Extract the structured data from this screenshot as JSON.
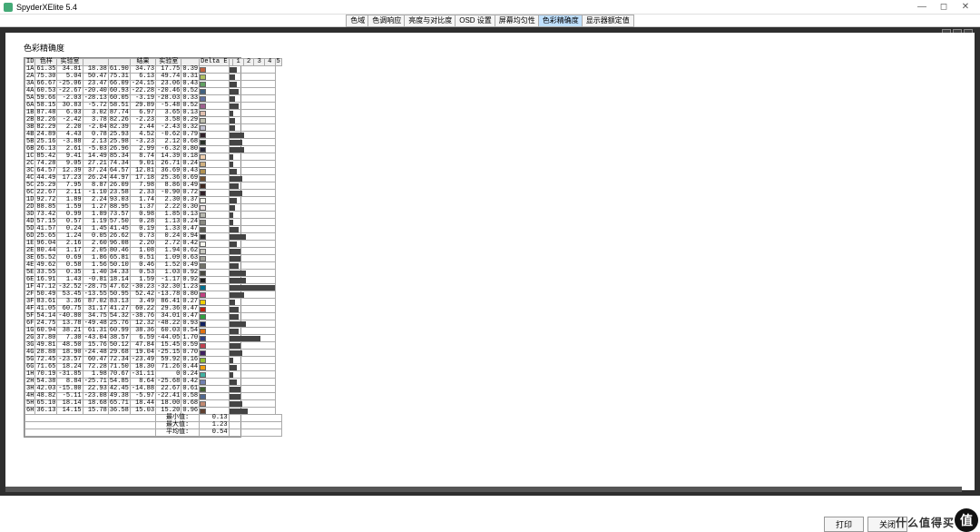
{
  "app": {
    "title": "SpyderXElite 5.4"
  },
  "winbtns": {
    "min": "—",
    "max": "◻",
    "close": "✕"
  },
  "tabs": [
    {
      "label": "色域"
    },
    {
      "label": "色调响应"
    },
    {
      "label": "亮度与对比度"
    },
    {
      "label": "OSD 设置"
    },
    {
      "label": "屏幕均匀性"
    },
    {
      "label": "色彩精确度",
      "active": true
    },
    {
      "label": "显示器额定值"
    }
  ],
  "page": {
    "title": "色彩精确度"
  },
  "columns": [
    "ID",
    "色样",
    "实验室",
    "",
    "",
    "结果",
    "实验室",
    "",
    "Delta E",
    "1",
    "2",
    "3",
    "4",
    "5"
  ],
  "rows": [
    {
      "id": "1A",
      "v": [
        "61.35",
        "34.81",
        "18.38",
        "61.90",
        "34.73",
        "17.75"
      ],
      "de": "0.39",
      "c": "#c06040",
      "b": 4
    },
    {
      "id": "2A",
      "v": [
        "75.30",
        "5.04",
        "50.47",
        "75.31",
        "6.13",
        "49.74"
      ],
      "de": "0.31",
      "c": "#b0c060",
      "b": 3
    },
    {
      "id": "3A",
      "v": [
        "66.67",
        "-25.06",
        "23.47",
        "66.09",
        "-24.15",
        "23.06"
      ],
      "de": "0.43",
      "c": "#60a060",
      "b": 4
    },
    {
      "id": "4A",
      "v": [
        "60.53",
        "-22.67",
        "-20.40",
        "60.93",
        "-22.28",
        "-20.46"
      ],
      "de": "0.52",
      "c": "#406080",
      "b": 5
    },
    {
      "id": "5A",
      "v": [
        "59.66",
        "-2.03",
        "-28.13",
        "60.05",
        "-3.19",
        "-28.03"
      ],
      "de": "0.33",
      "c": "#6070a0",
      "b": 3
    },
    {
      "id": "6A",
      "v": [
        "58.15",
        "30.83",
        "-5.72",
        "58.51",
        "29.89",
        "-5.48"
      ],
      "de": "0.52",
      "c": "#a06090",
      "b": 5
    },
    {
      "id": "1B",
      "v": [
        "87.48",
        "6.03",
        "3.02",
        "87.74",
        "6.97",
        "3.65"
      ],
      "de": "0.13",
      "c": "#e0c0b0",
      "b": 2
    },
    {
      "id": "2B",
      "v": [
        "82.26",
        "-2.42",
        "3.78",
        "82.26",
        "-2.23",
        "3.58"
      ],
      "de": "0.29",
      "c": "#c0c0b0",
      "b": 3
    },
    {
      "id": "3B",
      "v": [
        "82.29",
        "2.20",
        "-2.04",
        "82.39",
        "2.44",
        "-2.43"
      ],
      "de": "0.32",
      "c": "#c0c0d0",
      "b": 3
    },
    {
      "id": "4B",
      "v": [
        "24.89",
        "4.43",
        "0.78",
        "25.93",
        "4.52",
        "-0.62"
      ],
      "de": "0.79",
      "c": "#302028",
      "b": 8
    },
    {
      "id": "5B",
      "v": [
        "25.16",
        "-3.88",
        "2.13",
        "25.98",
        "-3.23",
        "2.12"
      ],
      "de": "0.68",
      "c": "#283028",
      "b": 7
    },
    {
      "id": "6B",
      "v": [
        "26.13",
        "2.61",
        "-5.03",
        "26.96",
        "2.99",
        "-6.32"
      ],
      "de": "0.80",
      "c": "#282838",
      "b": 8
    },
    {
      "id": "1C",
      "v": [
        "85.42",
        "9.41",
        "14.49",
        "85.34",
        "8.74",
        "14.39"
      ],
      "de": "0.18",
      "c": "#f0d0b0",
      "b": 2
    },
    {
      "id": "2C",
      "v": [
        "74.28",
        "9.05",
        "27.21",
        "74.34",
        "9.01",
        "26.71"
      ],
      "de": "0.24",
      "c": "#d0b080",
      "b": 2
    },
    {
      "id": "3C",
      "v": [
        "64.57",
        "12.39",
        "37.24",
        "64.57",
        "12.81",
        "36.69"
      ],
      "de": "0.43",
      "c": "#b09050",
      "b": 4
    },
    {
      "id": "4C",
      "v": [
        "44.49",
        "17.23",
        "26.24",
        "44.97",
        "17.18",
        "25.36"
      ],
      "de": "0.69",
      "c": "#705030",
      "b": 7
    },
    {
      "id": "5C",
      "v": [
        "25.29",
        "7.95",
        "8.87",
        "26.09",
        "7.98",
        "8.86"
      ],
      "de": "0.49",
      "c": "#402820",
      "b": 5
    },
    {
      "id": "6C",
      "v": [
        "22.67",
        "2.11",
        "-1.10",
        "23.58",
        "2.33",
        "-0.90"
      ],
      "de": "0.72",
      "c": "#302028",
      "b": 7
    },
    {
      "id": "1D",
      "v": [
        "92.72",
        "1.89",
        "2.24",
        "93.03",
        "1.74",
        "2.30"
      ],
      "de": "0.37",
      "c": "#f0f0e8",
      "b": 4
    },
    {
      "id": "2D",
      "v": [
        "88.85",
        "1.59",
        "1.27",
        "88.95",
        "1.37",
        "2.22"
      ],
      "de": "0.30",
      "c": "#e8e0e0",
      "b": 3
    },
    {
      "id": "3D",
      "v": [
        "73.42",
        "0.99",
        "1.89",
        "73.57",
        "0.98",
        "1.85"
      ],
      "de": "0.13",
      "c": "#b8b8b0",
      "b": 2
    },
    {
      "id": "4D",
      "v": [
        "57.15",
        "0.57",
        "1.19",
        "57.50",
        "0.28",
        "1.13"
      ],
      "de": "0.24",
      "c": "#888880",
      "b": 2
    },
    {
      "id": "5D",
      "v": [
        "41.57",
        "0.24",
        "1.45",
        "41.45",
        "0.19",
        "1.33"
      ],
      "de": "0.47",
      "c": "#585850",
      "b": 5
    },
    {
      "id": "6D",
      "v": [
        "25.65",
        "1.24",
        "0.05",
        "26.62",
        "0.73",
        "0.24"
      ],
      "de": "0.94",
      "c": "#303030",
      "b": 9
    },
    {
      "id": "1E",
      "v": [
        "96.04",
        "2.16",
        "2.60",
        "96.08",
        "2.20",
        "2.72"
      ],
      "de": "0.42",
      "c": "#f8f8f0",
      "b": 4
    },
    {
      "id": "2E",
      "v": [
        "80.44",
        "1.17",
        "2.05",
        "80.46",
        "1.08",
        "1.94"
      ],
      "de": "0.62",
      "c": "#c8c8c0",
      "b": 6
    },
    {
      "id": "3E",
      "v": [
        "65.52",
        "0.69",
        "1.86",
        "65.81",
        "0.51",
        "1.09"
      ],
      "de": "0.63",
      "c": "#a0a098",
      "b": 6
    },
    {
      "id": "4E",
      "v": [
        "49.62",
        "0.58",
        "1.56",
        "50.10",
        "0.46",
        "1.52"
      ],
      "de": "0.49",
      "c": "#707068",
      "b": 5
    },
    {
      "id": "5E",
      "v": [
        "33.55",
        "0.35",
        "1.40",
        "34.33",
        "0.53",
        "1.03"
      ],
      "de": "0.92",
      "c": "#484840",
      "b": 9
    },
    {
      "id": "6E",
      "v": [
        "16.91",
        "1.43",
        "-0.81",
        "18.14",
        "1.59",
        "-1.17"
      ],
      "de": "0.92",
      "c": "#202020",
      "b": 9
    },
    {
      "id": "1F",
      "v": [
        "47.12",
        "-32.52",
        "-28.75",
        "47.62",
        "-30.23",
        "-32.30"
      ],
      "de": "1.23",
      "c": "#007090",
      "b": 25
    },
    {
      "id": "2F",
      "v": [
        "50.49",
        "53.45",
        "-13.55",
        "50.95",
        "52.42",
        "-13.78"
      ],
      "de": "0.80",
      "c": "#c04080",
      "b": 8
    },
    {
      "id": "3F",
      "v": [
        "83.61",
        "3.36",
        "87.02",
        "83.13",
        "3.49",
        "86.41"
      ],
      "de": "0.27",
      "c": "#f0d000",
      "b": 3
    },
    {
      "id": "4F",
      "v": [
        "41.05",
        "60.75",
        "31.17",
        "41.27",
        "60.22",
        "29.36"
      ],
      "de": "0.47",
      "c": "#c02010",
      "b": 5
    },
    {
      "id": "5F",
      "v": [
        "54.14",
        "-40.80",
        "34.75",
        "54.32",
        "-38.76",
        "34.01"
      ],
      "de": "0.47",
      "c": "#30a040",
      "b": 5
    },
    {
      "id": "6F",
      "v": [
        "24.75",
        "13.78",
        "-49.48",
        "25.76",
        "12.32",
        "-48.22"
      ],
      "de": "0.93",
      "c": "#102060",
      "b": 9
    },
    {
      "id": "1G",
      "v": [
        "60.94",
        "38.21",
        "61.31",
        "60.99",
        "38.36",
        "60.03"
      ],
      "de": "0.54",
      "c": "#e07010",
      "b": 5
    },
    {
      "id": "2G",
      "v": [
        "37.80",
        "7.30",
        "-43.04",
        "38.57",
        "6.59",
        "-44.05"
      ],
      "de": "1.70",
      "c": "#304080",
      "b": 17
    },
    {
      "id": "3G",
      "v": [
        "49.81",
        "48.50",
        "15.76",
        "50.12",
        "47.84",
        "15.45"
      ],
      "de": "0.59",
      "c": "#c04050",
      "b": 6
    },
    {
      "id": "4G",
      "v": [
        "28.88",
        "18.90",
        "-24.48",
        "29.68",
        "19.04",
        "-25.15"
      ],
      "de": "0.70",
      "c": "#402060",
      "b": 7
    },
    {
      "id": "5G",
      "v": [
        "72.45",
        "-23.57",
        "60.47",
        "72.34",
        "-23.49",
        "59.92"
      ],
      "de": "0.16",
      "c": "#90c030",
      "b": 2
    },
    {
      "id": "6G",
      "v": [
        "71.65",
        "18.24",
        "72.28",
        "71.50",
        "18.30",
        "71.26"
      ],
      "de": "0.44",
      "c": "#f0a010",
      "b": 4
    },
    {
      "id": "1H",
      "v": [
        "70.19",
        "-31.85",
        "1.98",
        "70.67",
        "-31.11",
        "0"
      ],
      "de": "0.24",
      "c": "#40b0a0",
      "b": 2
    },
    {
      "id": "2H",
      "v": [
        "54.38",
        "8.84",
        "-25.71",
        "54.85",
        "8.64",
        "-25.68"
      ],
      "de": "0.42",
      "c": "#7080b0",
      "b": 4
    },
    {
      "id": "3H",
      "v": [
        "42.03",
        "-15.80",
        "22.93",
        "42.45",
        "-14.88",
        "22.67"
      ],
      "de": "0.61",
      "c": "#406030",
      "b": 6
    },
    {
      "id": "4H",
      "v": [
        "48.82",
        "-5.11",
        "-23.08",
        "49.38",
        "-5.97",
        "-22.41"
      ],
      "de": "0.58",
      "c": "#506890",
      "b": 6
    },
    {
      "id": "5H",
      "v": [
        "65.10",
        "18.14",
        "18.68",
        "65.71",
        "18.44",
        "18.00"
      ],
      "de": "0.68",
      "c": "#c08870",
      "b": 7
    },
    {
      "id": "6H",
      "v": [
        "36.13",
        "14.15",
        "15.78",
        "36.58",
        "15.03",
        "15.20"
      ],
      "de": "0.96",
      "c": "#604030",
      "b": 10
    }
  ],
  "summary": [
    {
      "label": "最小值:",
      "val": "0.13"
    },
    {
      "label": "最大值:",
      "val": "1.23"
    },
    {
      "label": "平均值:",
      "val": "0.54"
    }
  ],
  "footer": {
    "print": "打印",
    "close": "关闭"
  },
  "watermark": {
    "text": "什么值得买",
    "badge": "值"
  }
}
